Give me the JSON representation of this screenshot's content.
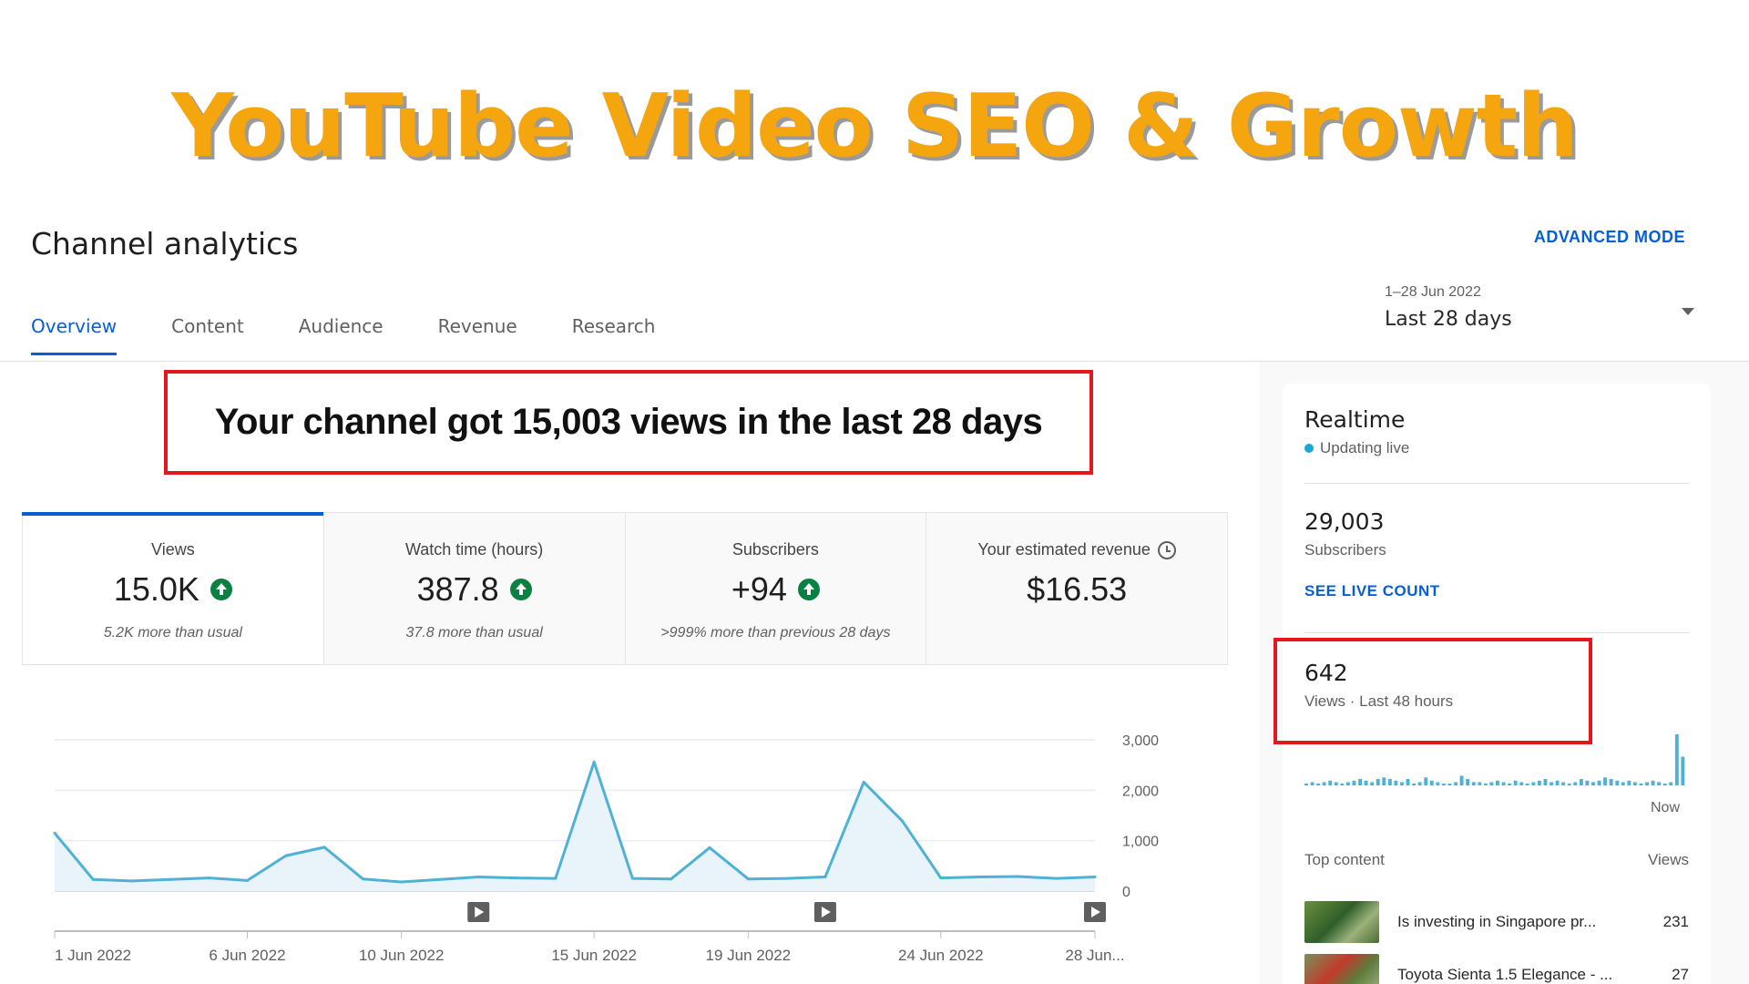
{
  "banner": {
    "title": "YouTube Video SEO & Growth"
  },
  "header": {
    "title": "Channel analytics",
    "advanced_mode": "ADVANCED MODE",
    "tabs": [
      {
        "label": "Overview",
        "active": true
      },
      {
        "label": "Content"
      },
      {
        "label": "Audience"
      },
      {
        "label": "Revenue"
      },
      {
        "label": "Research"
      }
    ],
    "date_picker": {
      "range": "1–28 Jun 2022",
      "label": "Last 28 days"
    }
  },
  "main": {
    "headline": "Your channel got 15,003 views in the last 28 days",
    "metrics": [
      {
        "label": "Views",
        "value": "15.0K",
        "sub": "5.2K more than usual",
        "trend": "up",
        "active": true
      },
      {
        "label": "Watch time (hours)",
        "value": "387.8",
        "sub": "37.8 more than usual",
        "trend": "up"
      },
      {
        "label": "Subscribers",
        "value": "+94",
        "sub": ">999% more than previous 28 days",
        "trend": "up"
      },
      {
        "label": "Your estimated revenue",
        "value": "$16.53",
        "sub": "",
        "trend": "none"
      }
    ]
  },
  "chart_data": {
    "type": "area",
    "x": [
      "1 Jun 2022",
      "2 Jun 2022",
      "3 Jun 2022",
      "4 Jun 2022",
      "5 Jun 2022",
      "6 Jun 2022",
      "7 Jun 2022",
      "8 Jun 2022",
      "9 Jun 2022",
      "10 Jun 2022",
      "11 Jun 2022",
      "12 Jun 2022",
      "13 Jun 2022",
      "14 Jun 2022",
      "15 Jun 2022",
      "16 Jun 2022",
      "17 Jun 2022",
      "18 Jun 2022",
      "19 Jun 2022",
      "20 Jun 2022",
      "21 Jun 2022",
      "22 Jun 2022",
      "23 Jun 2022",
      "24 Jun 2022",
      "25 Jun 2022",
      "26 Jun 2022",
      "27 Jun 2022",
      "28 Jun 2022"
    ],
    "values": [
      1150,
      230,
      200,
      230,
      260,
      210,
      700,
      870,
      240,
      180,
      230,
      280,
      260,
      250,
      2560,
      250,
      240,
      860,
      240,
      250,
      280,
      2160,
      1390,
      260,
      280,
      290,
      250,
      280
    ],
    "x_tick_labels": [
      "1 Jun 2022",
      "6 Jun 2022",
      "10 Jun 2022",
      "15 Jun 2022",
      "19 Jun 2022",
      "24 Jun 2022",
      "28 Jun..."
    ],
    "x_tick_index": [
      0,
      5,
      9,
      14,
      18,
      23,
      27
    ],
    "y_ticks": [
      0,
      1000,
      2000,
      3000
    ],
    "y_tick_labels": [
      "0",
      "1,000",
      "2,000",
      "3,000"
    ],
    "ylim": [
      0,
      3000
    ],
    "video_markers_index": [
      11,
      20,
      27
    ],
    "grid": true,
    "color": "#4fb1d6",
    "fill": "#e8f4f9"
  },
  "realtime": {
    "title": "Realtime",
    "status": "Updating live",
    "subscribers": "29,003",
    "subscribers_label": "Subscribers",
    "see_live_count": "SEE LIVE COUNT",
    "views": "642",
    "views_label": "Views · Last 48 hours",
    "sparkline": [
      1,
      2,
      1,
      2,
      3,
      2,
      1,
      2,
      3,
      4,
      3,
      2,
      4,
      5,
      4,
      3,
      2,
      4,
      1,
      2,
      5,
      3,
      2,
      1,
      1,
      2,
      6,
      4,
      2,
      2,
      1,
      2,
      3,
      2,
      1,
      3,
      2,
      1,
      2,
      3,
      4,
      2,
      3,
      2,
      1,
      2,
      4,
      3,
      2,
      3,
      5,
      4,
      3,
      2,
      3,
      2,
      1,
      2,
      3,
      2,
      1,
      2,
      32,
      18
    ],
    "now_label": "Now",
    "top_content_label": "Top content",
    "views_col_label": "Views",
    "top_content": [
      {
        "title": "Is investing in Singapore pr...",
        "views": "231"
      },
      {
        "title": "Toyota Sienta 1.5 Elegance - ...",
        "views": "27"
      }
    ]
  },
  "colors": {
    "accent": "#065fd4",
    "banner": "#f5a60e",
    "highlight_box": "#e5161e",
    "trend_up": "#0b8043"
  }
}
